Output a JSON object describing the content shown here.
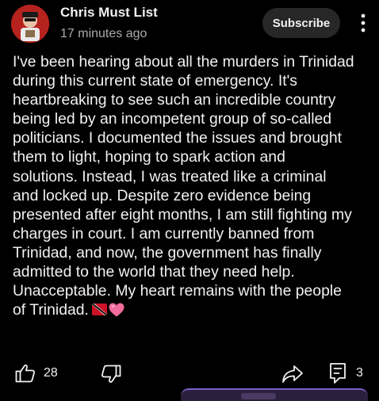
{
  "post": {
    "channel_name": "Chris Must List",
    "timestamp": "17 minutes ago",
    "subscribe_label": "Subscribe",
    "text_lines": [
      "I've been hearing about all the murders in Trinidad",
      "during this current state of emergency. It's",
      "heartbreaking to see such an incredible country",
      "being led by an incompetent group of so-called",
      "politicians. I documented the issues and brought",
      "them to light, hoping to spark action and",
      "solutions. Instead, I was treated like a criminal",
      "and locked up. Despite zero evidence being",
      "presented after eight months, I am still fighting my",
      "charges in court. I am currently banned from",
      "Trinidad, and now, the government has finally",
      "admitted to the world that they need help.",
      "Unacceptable. My heart remains with the people",
      "of Trinidad."
    ],
    "emojis": [
      "trinidad-and-tobago-flag",
      "pink-heart"
    ]
  },
  "actions": {
    "like_count": "28",
    "comment_count": "3",
    "icons": [
      "thumbs-up-icon",
      "thumbs-down-icon",
      "share-icon",
      "comment-icon",
      "more-vert-icon"
    ]
  },
  "colors": {
    "background": "#000000",
    "text": "#f1f1f1",
    "secondary_text": "#aaaaaa",
    "subscribe_bg": "#272727",
    "avatar_bg": "#b6231f"
  }
}
